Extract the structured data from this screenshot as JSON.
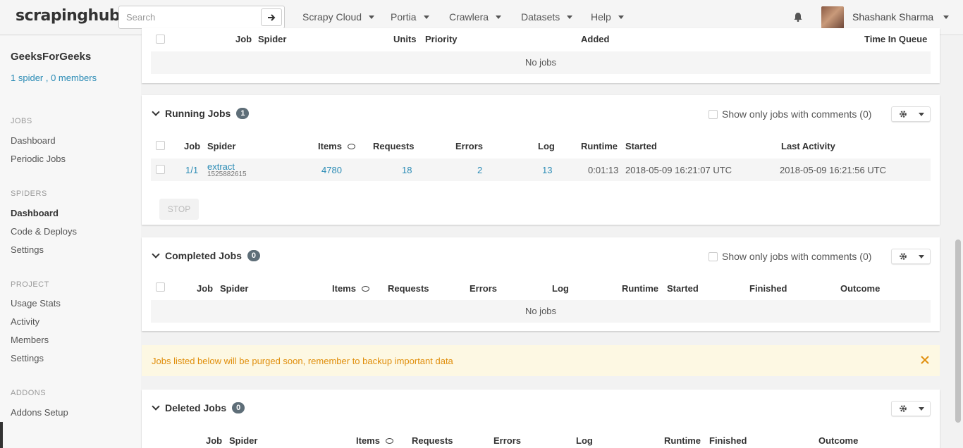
{
  "topbar": {
    "logo": "scrapinghub",
    "search_placeholder": "Search",
    "nav": [
      "Scrapy Cloud",
      "Portia",
      "Crawlera",
      "Datasets",
      "Help"
    ],
    "user_name": "Shashank Sharma"
  },
  "sidebar": {
    "project_name": "GeeksForGeeks",
    "project_meta": "1 spider , 0 members",
    "sections": [
      {
        "heading": "JOBS",
        "items": [
          "Dashboard",
          "Periodic Jobs"
        ]
      },
      {
        "heading": "SPIDERS",
        "items": [
          "Dashboard",
          "Code & Deploys",
          "Settings"
        ]
      },
      {
        "heading": "PROJECT",
        "items": [
          "Usage Stats",
          "Activity",
          "Members",
          "Settings"
        ]
      },
      {
        "heading": "ADDONS",
        "items": [
          "Addons Setup"
        ]
      }
    ],
    "active_item": "Dashboard"
  },
  "pending": {
    "columns": [
      "Job",
      "Spider",
      "Units",
      "Priority",
      "Added",
      "Time In Queue"
    ],
    "empty": "No jobs"
  },
  "running": {
    "title": "Running Jobs",
    "count": "1",
    "filter_label": "Show only jobs with comments (0)",
    "columns": [
      "Job",
      "Spider",
      "Items",
      "Requests",
      "Errors",
      "Log",
      "Runtime",
      "Started",
      "Last Activity"
    ],
    "row": {
      "job": "1/1",
      "spider": "extract",
      "spider_sub": "1525882615",
      "items": "4780",
      "requests": "18",
      "errors": "2",
      "log": "13",
      "runtime": "0:01:13",
      "started": "2018-05-09 16:21:07 UTC",
      "last_activity": "2018-05-09 16:21:56 UTC"
    },
    "stop_label": "STOP"
  },
  "completed": {
    "title": "Completed Jobs",
    "count": "0",
    "filter_label": "Show only jobs with comments (0)",
    "columns": [
      "Job",
      "Spider",
      "Items",
      "Requests",
      "Errors",
      "Log",
      "Runtime",
      "Started",
      "Finished",
      "Outcome"
    ],
    "empty": "No jobs"
  },
  "alert": {
    "text": "Jobs listed below will be purged soon, remember to backup important data",
    "color": "#e08e0b"
  },
  "deleted": {
    "title": "Deleted Jobs",
    "count": "0",
    "columns": [
      "Job",
      "Spider",
      "Items",
      "Requests",
      "Errors",
      "Log",
      "Runtime",
      "Finished",
      "Outcome"
    ]
  },
  "colors": {
    "link": "#2a8bb5",
    "badge": "#5e6e78",
    "alert_bg": "#fdf8e3"
  }
}
